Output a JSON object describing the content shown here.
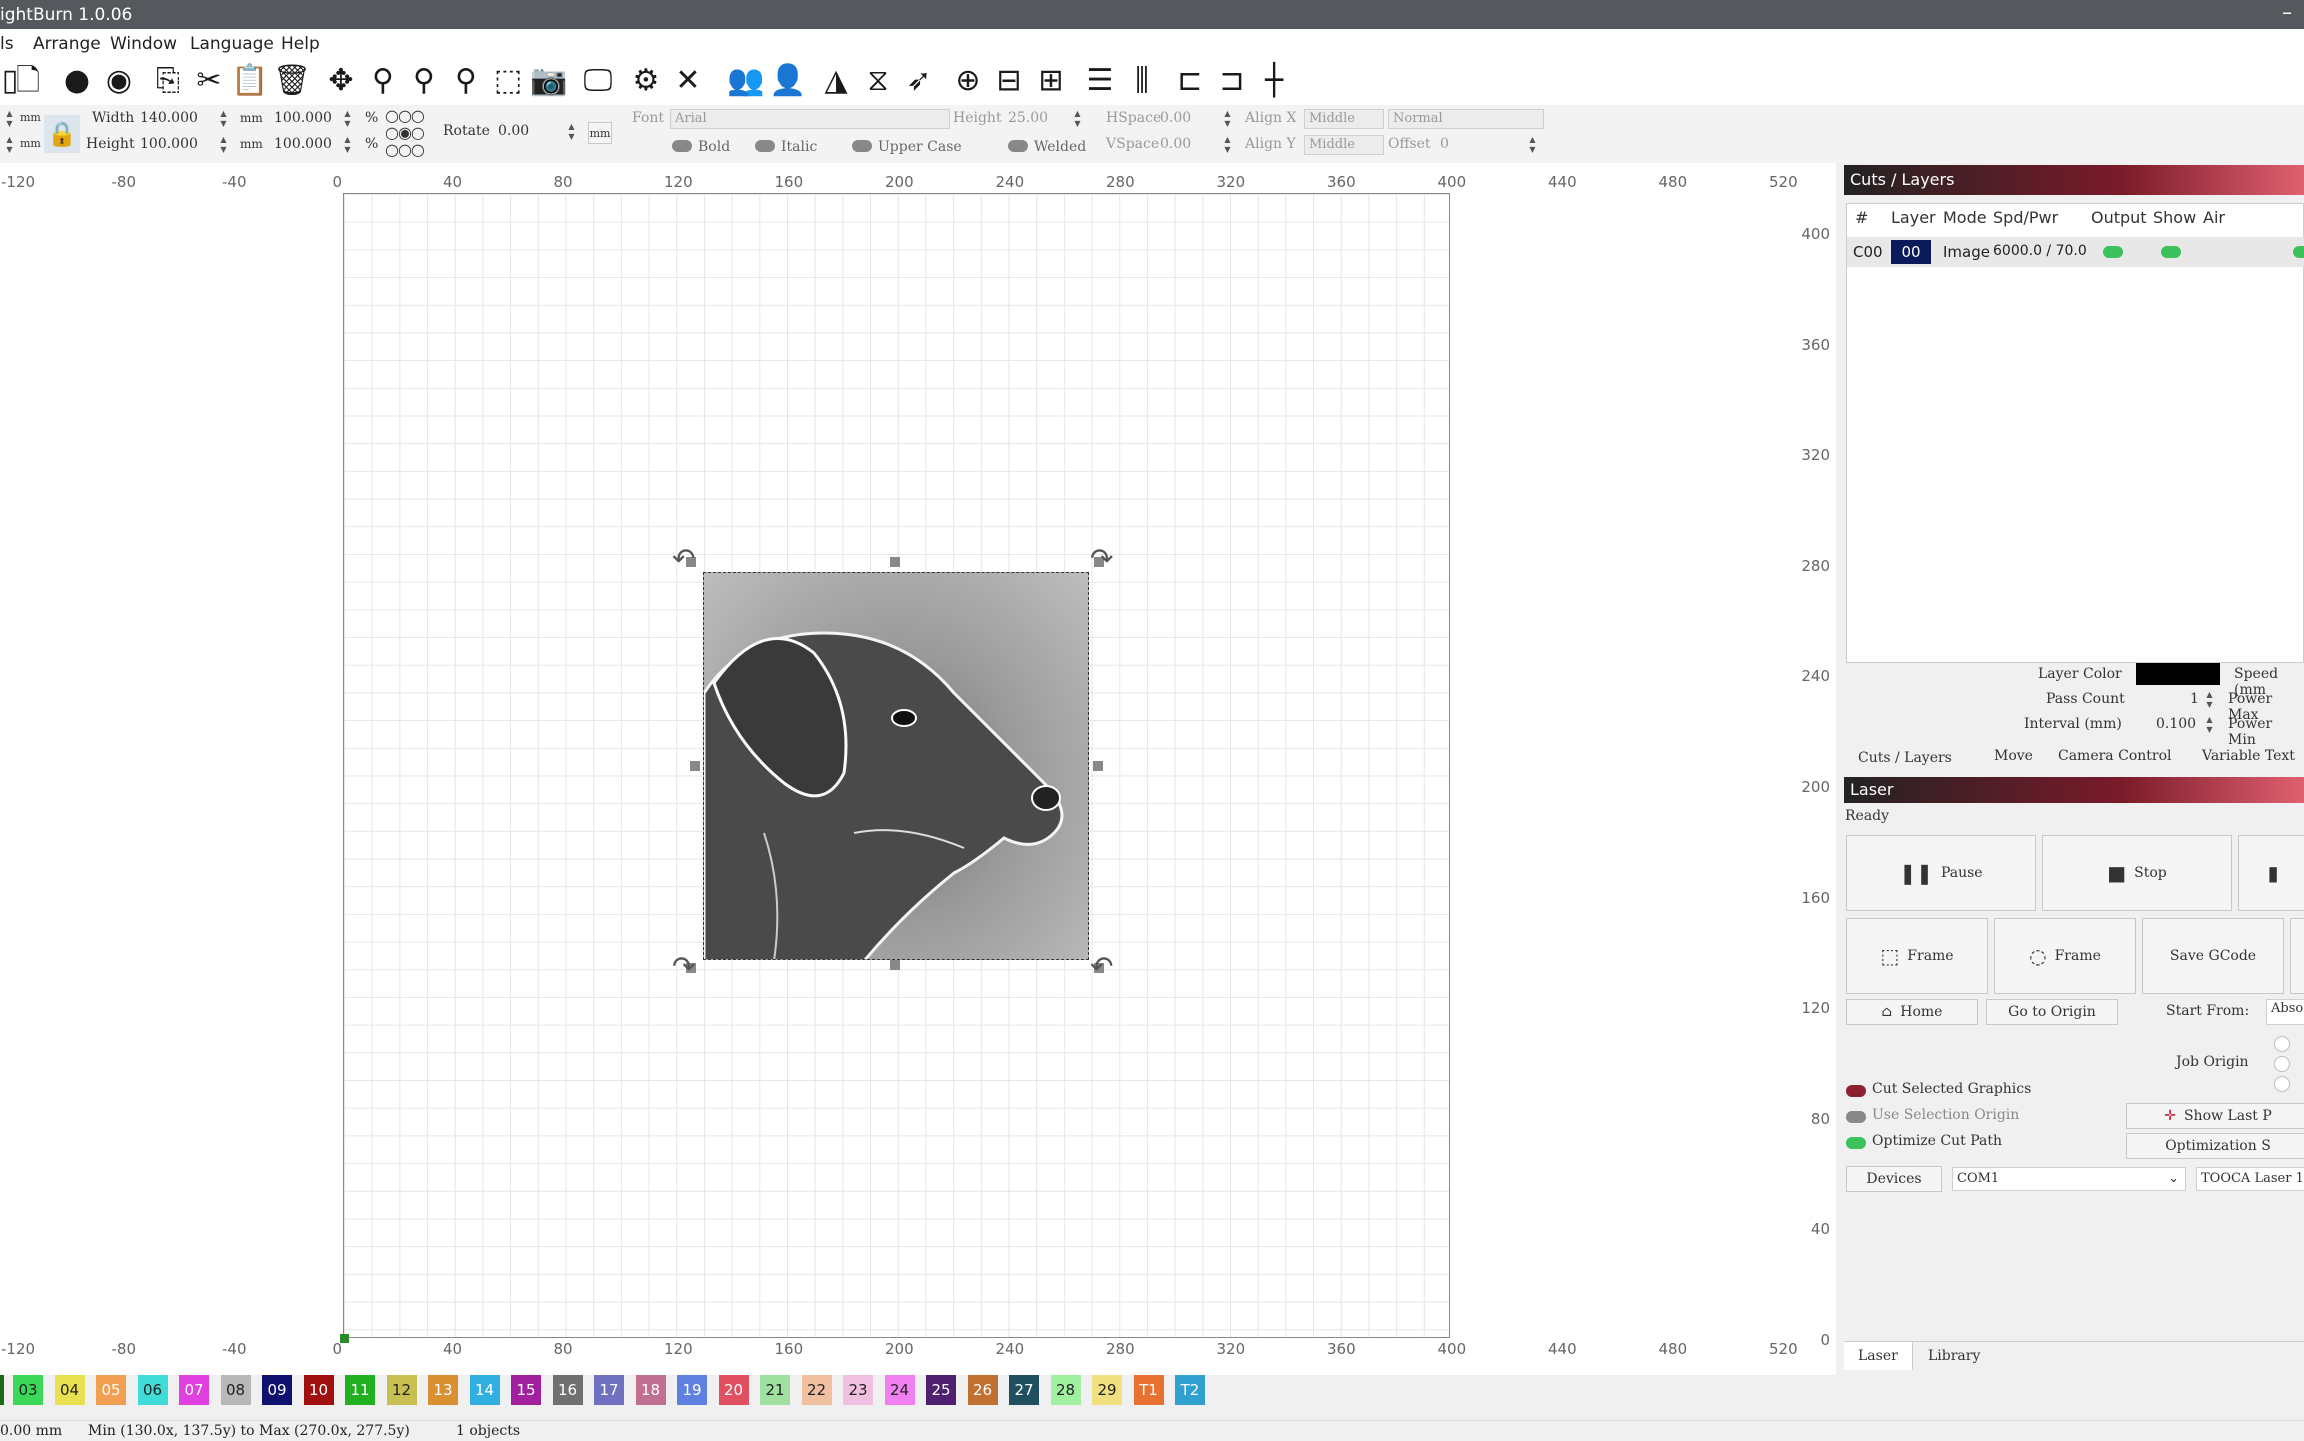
{
  "app": {
    "title": "ightBurn 1.0.06"
  },
  "menu": {
    "items": [
      "ls",
      "Arrange",
      "Window",
      "Language",
      "Help"
    ]
  },
  "toolbar": {
    "icons": [
      "new-icon",
      "import-icon",
      "undo-icon",
      "redo-icon",
      "copy-icon",
      "cut-icon",
      "paste-icon",
      "delete-icon",
      "move-icon",
      "zoom-icon",
      "zoom-in-icon",
      "zoom-out-icon",
      "select-icon",
      "camera-icon",
      "monitor-icon",
      "settings-icon",
      "tools-icon",
      "group-icon",
      "user-icon",
      "send-icon",
      "mirror-icon",
      "paper-plane-icon",
      "target-icon",
      "align-icon",
      "distribute-icon",
      "align-v-icon",
      "distribute-v-icon",
      "space-h-icon",
      "space-v-icon",
      "origin-icon"
    ]
  },
  "props": {
    "unit_mm": "mm",
    "width_label": "Width",
    "width_value": "140.000",
    "height_label": "Height",
    "height_value": "100.000",
    "scale_w": "100.000",
    "scale_h": "100.000",
    "percent": "%",
    "rotate_label": "Rotate",
    "rotate_value": "0.00",
    "rotate_unit": "mm",
    "font_label": "Font",
    "font_value": "Arial",
    "text_height_label": "Height",
    "text_height_value": "25.00",
    "hspace_label": "HSpace",
    "hspace_value": "0.00",
    "vspace_label": "VSpace",
    "vspace_value": "0.00",
    "alignx_label": "Align X",
    "alignx_value": "Middle",
    "aligny_label": "Align Y",
    "aligny_value": "Middle",
    "normal_value": "Normal",
    "offset_label": "Offset",
    "offset_value": "0",
    "bold": "Bold",
    "italic": "Italic",
    "upper": "Upper Case",
    "welded": "Welded"
  },
  "ruler": {
    "x_ticks": [
      "-120",
      "-80",
      "-40",
      "0",
      "40",
      "80",
      "120",
      "160",
      "200",
      "240",
      "280",
      "320",
      "360",
      "400",
      "440",
      "480",
      "520"
    ],
    "y_ticks": [
      "400",
      "360",
      "320",
      "280",
      "240",
      "200",
      "160",
      "120",
      "80",
      "40",
      "0"
    ]
  },
  "cuts": {
    "title": "Cuts / Layers",
    "headers": [
      "#",
      "Layer",
      "Mode",
      "Spd/Pwr",
      "Output",
      "Show",
      "Air"
    ],
    "row": {
      "id": "C00",
      "layer": "00",
      "mode": "Image",
      "spdpwr": "6000.0 / 70.0"
    },
    "layer_color_label": "Layer Color",
    "speed_label": "Speed (mm",
    "pass_count_label": "Pass Count",
    "pass_count_value": "1",
    "power_max_label": "Power Max",
    "interval_label": "Interval (mm)",
    "interval_value": "0.100",
    "power_min_label": "Power Min",
    "tabs": [
      "Cuts / Layers",
      "Move",
      "Camera Control",
      "Variable Text"
    ]
  },
  "laser": {
    "title": "Laser",
    "status": "Ready",
    "pause": "Pause",
    "stop": "Stop",
    "frame1": "Frame",
    "frame2": "Frame",
    "save_gcode": "Save GCode",
    "home": "Home",
    "go_origin": "Go to Origin",
    "start_from_label": "Start From:",
    "start_from_value": "Abso",
    "job_origin": "Job Origin",
    "cut_selected": "Cut Selected Graphics",
    "use_selection": "Use Selection Origin",
    "optimize": "Optimize Cut Path",
    "show_last": "Show Last P",
    "optimization": "Optimization S",
    "devices": "Devices",
    "port": "COM1",
    "device_name": "TOOCA Laser 1",
    "bottom_tabs": [
      "Laser",
      "Library"
    ]
  },
  "palette": [
    {
      "label": "03",
      "color": "#3cd85a"
    },
    {
      "label": "04",
      "color": "#e8e050"
    },
    {
      "label": "05",
      "color": "#f0a050"
    },
    {
      "label": "06",
      "color": "#40dcd8"
    },
    {
      "label": "07",
      "color": "#e040e0"
    },
    {
      "label": "08",
      "color": "#b8b8b8"
    },
    {
      "label": "09",
      "color": "#101070"
    },
    {
      "label": "10",
      "color": "#a01010"
    },
    {
      "label": "11",
      "color": "#20b020"
    },
    {
      "label": "12",
      "color": "#c8c050"
    },
    {
      "label": "13",
      "color": "#d89030"
    },
    {
      "label": "14",
      "color": "#30b0e0"
    },
    {
      "label": "15",
      "color": "#a020a0"
    },
    {
      "label": "16",
      "color": "#707070"
    },
    {
      "label": "17",
      "color": "#7070c0"
    },
    {
      "label": "18",
      "color": "#c07090"
    },
    {
      "label": "19",
      "color": "#6080e0"
    },
    {
      "label": "20",
      "color": "#e05060"
    },
    {
      "label": "21",
      "color": "#a0e0a0"
    },
    {
      "label": "22",
      "color": "#f0c0a0"
    },
    {
      "label": "23",
      "color": "#f0c0e0"
    },
    {
      "label": "24",
      "color": "#f080f0"
    },
    {
      "label": "25",
      "color": "#502070"
    },
    {
      "label": "26",
      "color": "#c07030"
    },
    {
      "label": "27",
      "color": "#205060"
    },
    {
      "label": "28",
      "color": "#a0f0a0"
    },
    {
      "label": "29",
      "color": "#f0e080"
    },
    {
      "label": "T1",
      "color": "#e87030"
    },
    {
      "label": "T2",
      "color": "#30a0d0"
    }
  ],
  "statusbar": {
    "coord": "0.00 mm",
    "range": "Min (130.0x, 137.5y) to Max (270.0x, 277.5y)",
    "objects": "1 objects"
  }
}
